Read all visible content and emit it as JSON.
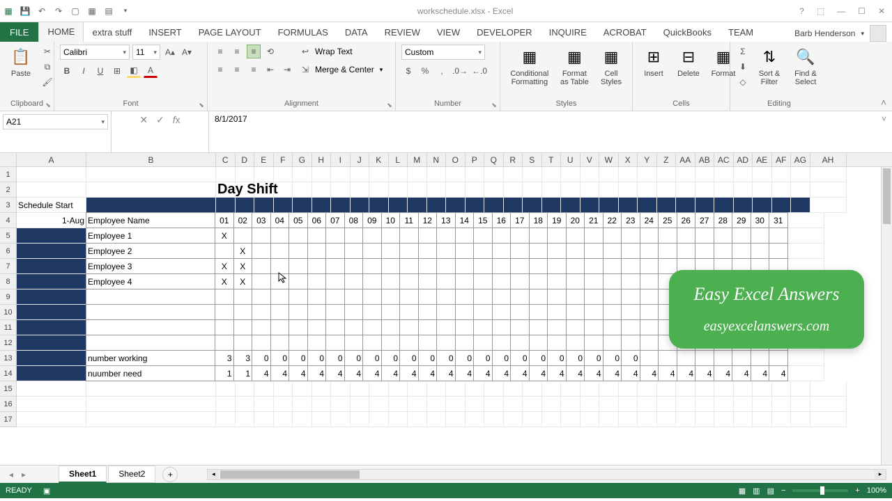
{
  "window": {
    "title": "workschedule.xlsx - Excel"
  },
  "user": {
    "name": "Barb Henderson"
  },
  "tabs": {
    "file": "FILE",
    "items": [
      "HOME",
      "extra stuff",
      "INSERT",
      "PAGE LAYOUT",
      "FORMULAS",
      "DATA",
      "REVIEW",
      "VIEW",
      "DEVELOPER",
      "INQUIRE",
      "ACROBAT",
      "QuickBooks",
      "TEAM"
    ],
    "active": "HOME"
  },
  "ribbon": {
    "clipboard": {
      "label": "Clipboard",
      "paste": "Paste"
    },
    "font": {
      "label": "Font",
      "name": "Calibri",
      "size": "11"
    },
    "alignment": {
      "label": "Alignment",
      "wrap": "Wrap Text",
      "merge": "Merge & Center"
    },
    "number": {
      "label": "Number",
      "format": "Custom"
    },
    "styles": {
      "label": "Styles",
      "cond": "Conditional Formatting",
      "table": "Format as Table",
      "cell": "Cell Styles"
    },
    "cells": {
      "label": "Cells",
      "insert": "Insert",
      "delete": "Delete",
      "format": "Format"
    },
    "editing": {
      "label": "Editing",
      "sort": "Sort & Filter",
      "find": "Find & Select"
    }
  },
  "namebox": "A21",
  "formula": "8/1/2017",
  "columns": [
    "A",
    "B",
    "C",
    "D",
    "E",
    "F",
    "G",
    "H",
    "I",
    "J",
    "K",
    "L",
    "M",
    "N",
    "O",
    "P",
    "Q",
    "R",
    "S",
    "T",
    "U",
    "V",
    "W",
    "X",
    "Y",
    "Z",
    "AA",
    "AB",
    "AC",
    "AD",
    "AE",
    "AF",
    "AG",
    "AH"
  ],
  "col_widths": {
    "A": 100,
    "B": 186,
    "other": 27.5,
    "AH": 52
  },
  "rows_shown": 17,
  "sheet": {
    "title": "Day Shift",
    "schedule_start_label": "Schedule Start",
    "schedule_start_value": "1-Aug",
    "employee_name_header": "Employee Name",
    "days": [
      "01",
      "02",
      "03",
      "04",
      "05",
      "06",
      "07",
      "08",
      "09",
      "10",
      "11",
      "12",
      "13",
      "14",
      "15",
      "16",
      "17",
      "18",
      "19",
      "20",
      "21",
      "22",
      "23",
      "24",
      "25",
      "26",
      "27",
      "28",
      "29",
      "30",
      "31"
    ],
    "employees": [
      {
        "name": "Employee 1",
        "marks": [
          "X",
          "",
          "",
          "",
          "",
          "",
          "",
          "",
          "",
          "",
          "",
          "",
          "",
          "",
          "",
          "",
          "",
          "",
          "",
          "",
          "",
          "",
          "",
          "",
          "",
          "",
          "",
          "",
          "",
          "",
          ""
        ]
      },
      {
        "name": "Employee 2",
        "marks": [
          "",
          "X",
          "",
          "",
          "",
          "",
          "",
          "",
          "",
          "",
          "",
          "",
          "",
          "",
          "",
          "",
          "",
          "",
          "",
          "",
          "",
          "",
          "",
          "",
          "",
          "",
          "",
          "",
          "",
          "",
          ""
        ]
      },
      {
        "name": "Employee 3",
        "marks": [
          "X",
          "X",
          "",
          "",
          "",
          "",
          "",
          "",
          "",
          "",
          "",
          "",
          "",
          "",
          "",
          "",
          "",
          "",
          "",
          "",
          "",
          "",
          "",
          "",
          "",
          "",
          "",
          "",
          "",
          "",
          ""
        ]
      },
      {
        "name": "Employee 4",
        "marks": [
          "X",
          "X",
          "",
          "",
          "",
          "",
          "",
          "",
          "",
          "",
          "",
          "",
          "",
          "",
          "",
          "",
          "",
          "",
          "",
          "",
          "",
          "",
          "",
          "",
          "",
          "",
          "",
          "",
          "",
          "",
          ""
        ]
      }
    ],
    "number_working_label": "number working",
    "number_working": [
      "3",
      "3",
      "0",
      "0",
      "0",
      "0",
      "0",
      "0",
      "0",
      "0",
      "0",
      "0",
      "0",
      "0",
      "0",
      "0",
      "0",
      "0",
      "0",
      "0",
      "0",
      "0",
      "0"
    ],
    "number_need_label": "nuumber need",
    "number_need": [
      "1",
      "1",
      "4",
      "4",
      "4",
      "4",
      "4",
      "4",
      "4",
      "4",
      "4",
      "4",
      "4",
      "4",
      "4",
      "4",
      "4",
      "4",
      "4",
      "4",
      "4",
      "4",
      "4",
      "4",
      "4",
      "4",
      "4",
      "4",
      "4",
      "4",
      "4"
    ]
  },
  "sheets": {
    "tabs": [
      "Sheet1",
      "Sheet2"
    ],
    "active": "Sheet1"
  },
  "status": {
    "ready": "READY",
    "zoom": "100%"
  },
  "overlay": {
    "title": "Easy Excel Answers",
    "url": "easyexcelanswers.com"
  }
}
